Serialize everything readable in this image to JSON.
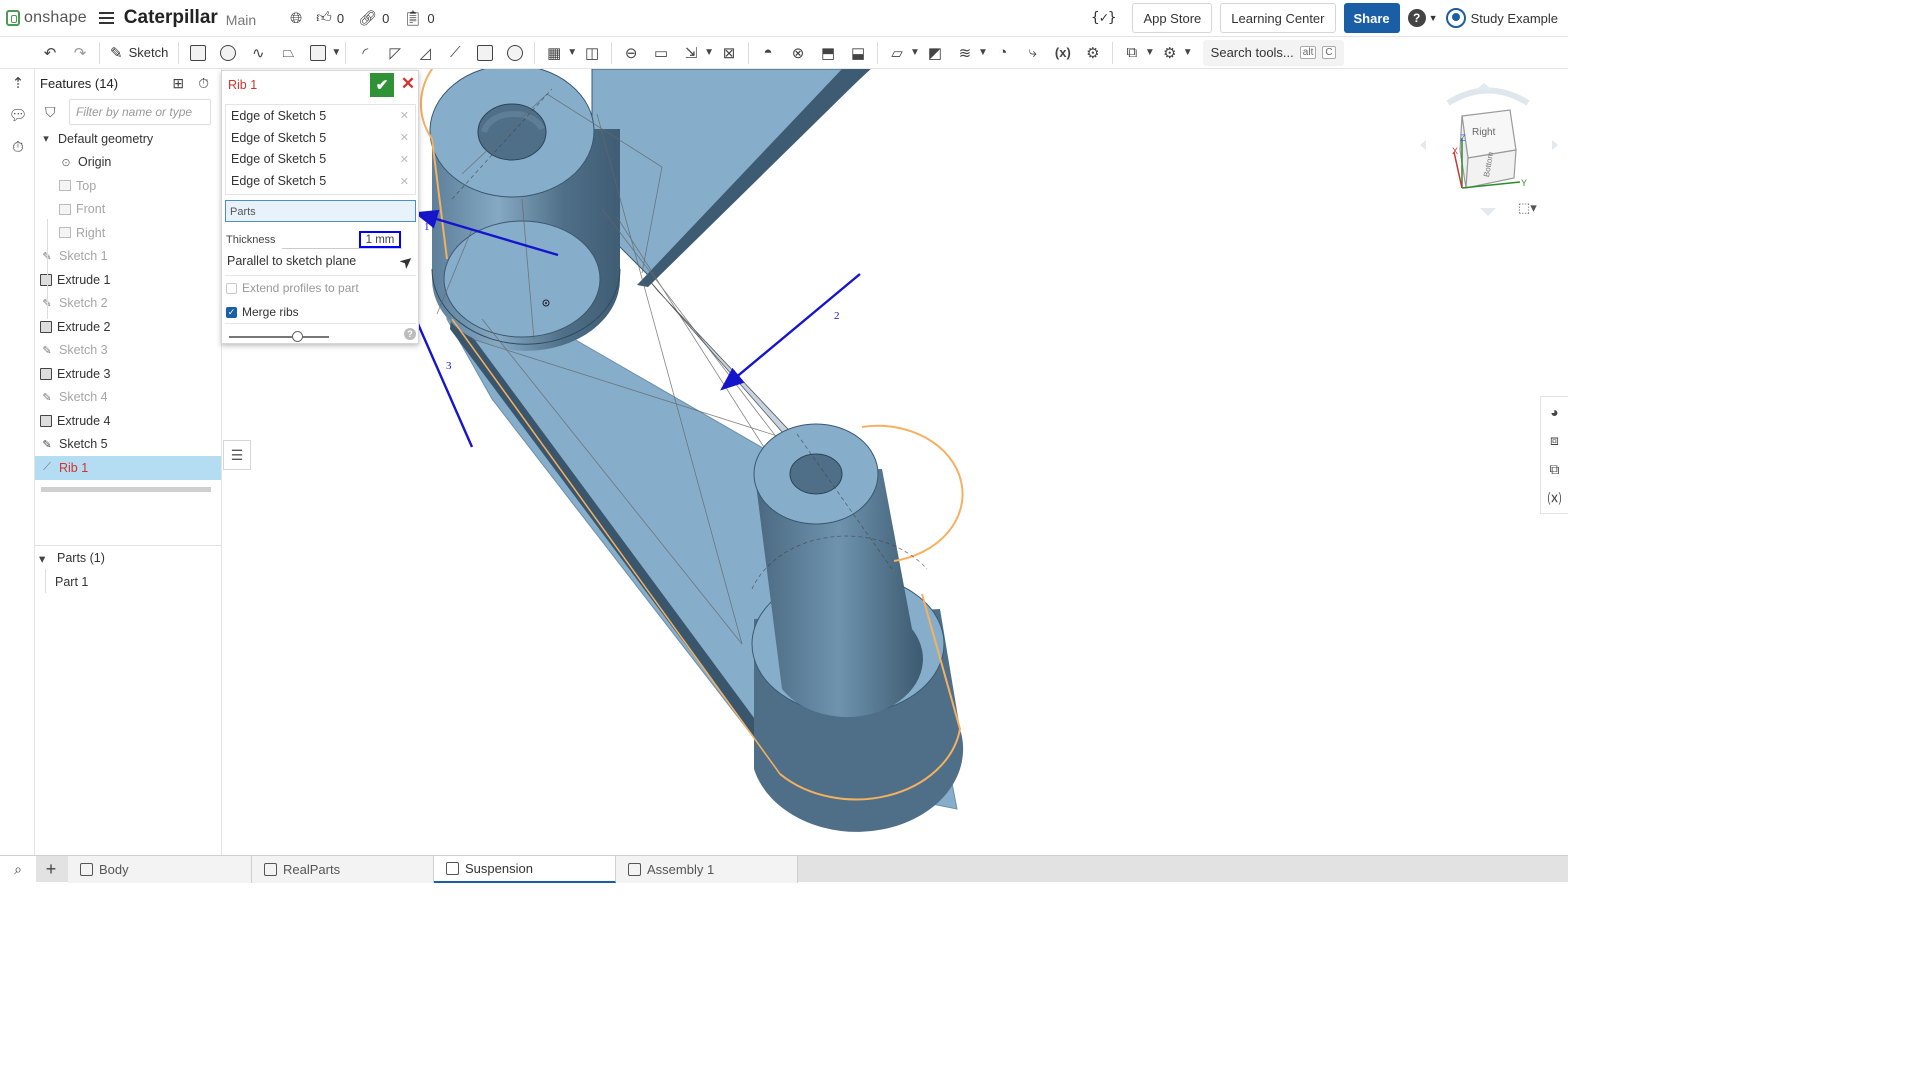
{
  "app": {
    "brand": "onshape",
    "doc_title": "Caterpillar",
    "workspace": "Main"
  },
  "topbar": {
    "likes": "0",
    "links": "0",
    "copies": "0",
    "variables_icon": "{✓}",
    "app_store": "App Store",
    "learning_center": "Learning Center",
    "share": "Share",
    "user": "Study Example"
  },
  "toolbar": {
    "sketch_label": "Sketch",
    "search_label": "Search tools...",
    "search_kbd_1": "alt",
    "search_kbd_2": "C"
  },
  "features": {
    "header": "Features (14)",
    "filter_placeholder": "Filter by name or type",
    "default_geometry": "Default geometry",
    "items": [
      {
        "label": "Origin",
        "state": "normal",
        "icon": "origin-icon"
      },
      {
        "label": "Top",
        "state": "muted",
        "icon": "plane-icon"
      },
      {
        "label": "Front",
        "state": "muted",
        "icon": "plane-icon"
      },
      {
        "label": "Right",
        "state": "muted",
        "icon": "plane-icon"
      },
      {
        "label": "Sketch 1",
        "state": "muted",
        "icon": "sketch-icon"
      },
      {
        "label": "Extrude 1",
        "state": "normal",
        "icon": "extrude-icon"
      },
      {
        "label": "Sketch 2",
        "state": "muted",
        "icon": "sketch-icon"
      },
      {
        "label": "Extrude 2",
        "state": "normal",
        "icon": "extrude-icon"
      },
      {
        "label": "Sketch 3",
        "state": "muted",
        "icon": "sketch-icon"
      },
      {
        "label": "Extrude 3",
        "state": "normal",
        "icon": "extrude-icon"
      },
      {
        "label": "Sketch 4",
        "state": "muted",
        "icon": "sketch-icon"
      },
      {
        "label": "Extrude 4",
        "state": "normal",
        "icon": "extrude-icon"
      },
      {
        "label": "Sketch 5",
        "state": "normal",
        "icon": "sketch-icon"
      },
      {
        "label": "Rib 1",
        "state": "selected",
        "icon": "rib-icon"
      }
    ],
    "parts_header": "Parts (1)",
    "parts": [
      "Part 1"
    ]
  },
  "rib": {
    "title": "Rib 1",
    "edges": [
      "Edge of Sketch 5",
      "Edge of Sketch 5",
      "Edge of Sketch 5",
      "Edge of Sketch 5"
    ],
    "parts_placeholder": "Parts",
    "thickness_label": "Thickness",
    "thickness_value": "1 mm",
    "parallel_label": "Parallel to sketch plane",
    "extend_label": "Extend profiles to part",
    "extend_checked": false,
    "merge_label": "Merge ribs",
    "merge_checked": true
  },
  "annotations": [
    "1",
    "2",
    "3"
  ],
  "viewcube": {
    "face_top": "Right",
    "face_side": "Bottom",
    "axis_x": "X",
    "axis_y": "Y",
    "axis_z": "Z"
  },
  "tabs": [
    {
      "label": "Body",
      "active": false
    },
    {
      "label": "RealParts",
      "active": false
    },
    {
      "label": "Suspension",
      "active": true
    },
    {
      "label": "Assembly 1",
      "active": false
    }
  ],
  "colors": {
    "accent": "#1a5ea6",
    "part_fill": "#86aecb",
    "part_dark": "#4f6f88",
    "selection_edge": "#f5b060",
    "annotation": "#1515cc",
    "confirm": "#2f9237",
    "cancel": "#d2332f"
  }
}
